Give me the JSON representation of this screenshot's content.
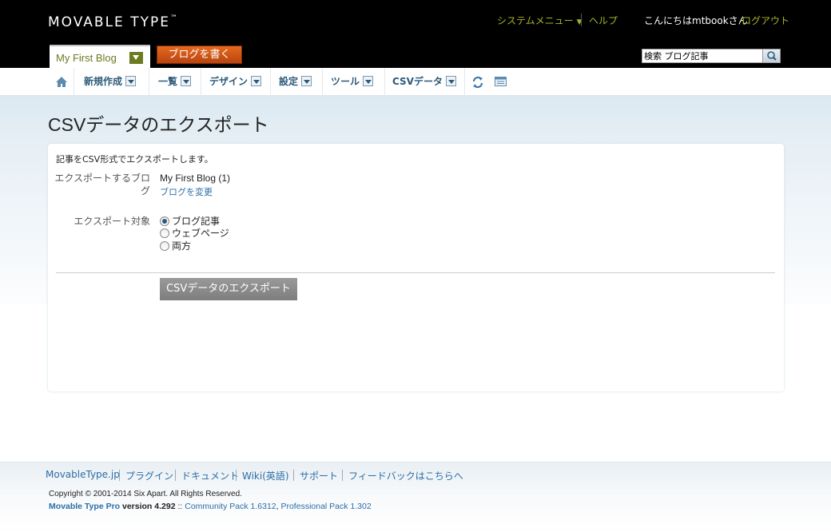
{
  "header": {
    "logo_text": "MOVABLE TYPE",
    "logo_tm": "™",
    "system_menu": "システムメニュー",
    "help": "ヘルプ",
    "greeting": "こんにちはmtbookさん",
    "logout": "ログアウト",
    "blog_name": "My First Blog",
    "write_button": "ブログを書く",
    "search_value": "検索 ブログ記事"
  },
  "nav": {
    "items": [
      {
        "label": "新規作成"
      },
      {
        "label": "一覧"
      },
      {
        "label": "デザイン"
      },
      {
        "label": "設定"
      },
      {
        "label": "ツール"
      },
      {
        "label": "CSVデータ"
      }
    ]
  },
  "main": {
    "title": "CSVデータのエクスポート",
    "intro": "記事をCSV形式でエクスポートします。",
    "blog_label_1": "エクスポートするブロ",
    "blog_label_2": "グ",
    "blog_value": "My First Blog (1)",
    "change_blog": "ブログを変更",
    "target_label": "エクスポート対象",
    "options": [
      {
        "label": "ブログ記事",
        "checked": true
      },
      {
        "label": "ウェブページ",
        "checked": false
      },
      {
        "label": "両方",
        "checked": false
      }
    ],
    "export_button": "CSVデータのエクスポート"
  },
  "footer": {
    "links": [
      "MovableType.jp",
      "プラグイン",
      "ドキュメント",
      "Wiki(英語)",
      "サポート",
      "フィードバックはこちらへ"
    ],
    "copyright": "Copyright © 2001-2014 Six Apart. All Rights Reserved.",
    "product": "Movable Type Pro",
    "version": "version 4.292",
    "separator": "::",
    "community_pack": "Community Pack 1.6312",
    "comma": ",",
    "professional_pack": "Professional Pack 1.302"
  },
  "colors": {
    "header_bg": "#000000",
    "accent_olive": "#a8b428",
    "write_button": "#d2561a",
    "nav_text": "#2c5a7a",
    "link": "#2c6ea8"
  }
}
